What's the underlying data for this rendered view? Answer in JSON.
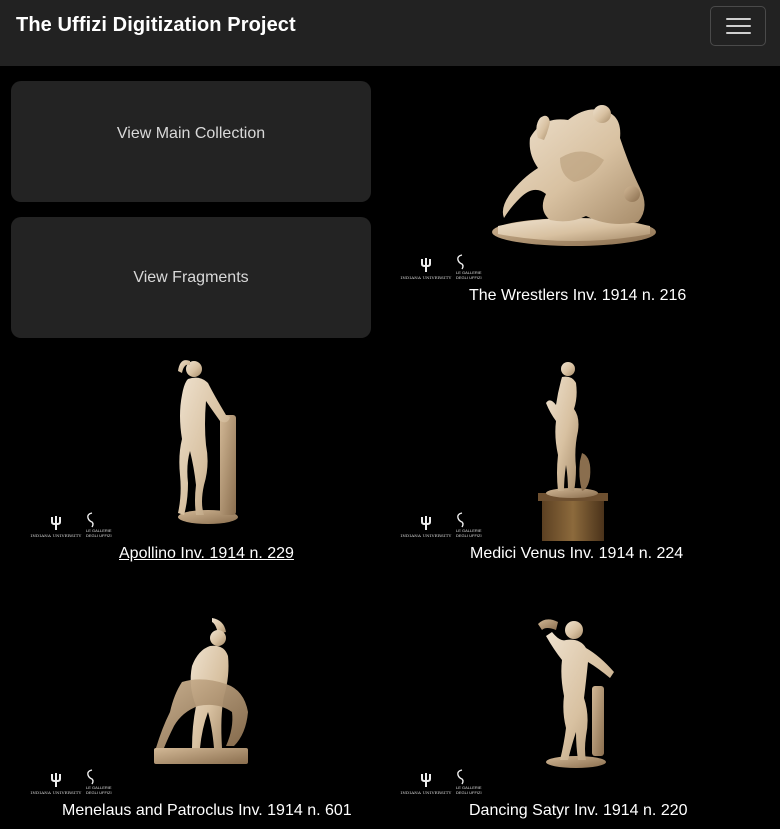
{
  "header": {
    "brand": "The Uffizi Digitization Project"
  },
  "actions": {
    "main_collection": "View Main Collection",
    "fragments": "View Fragments"
  },
  "logos": {
    "iu": "INDIANA UNIVERSITY",
    "uffizi_1": "LE GALLERIE",
    "uffizi_2": "DEGLI UFFIZI"
  },
  "sculptures": [
    {
      "title": "The Wrestlers Inv. 1914 n. 216"
    },
    {
      "title": "Apollino Inv. 1914 n. 229"
    },
    {
      "title": "Medici Venus Inv. 1914 n. 224"
    },
    {
      "title": "Menelaus and Patroclus Inv. 1914 n. 601"
    },
    {
      "title": "Dancing Satyr Inv. 1914 n. 220"
    }
  ],
  "colors": {
    "background": "#000000",
    "navbar": "#222222",
    "card": "#232323",
    "marble": "#d9c4a8"
  }
}
